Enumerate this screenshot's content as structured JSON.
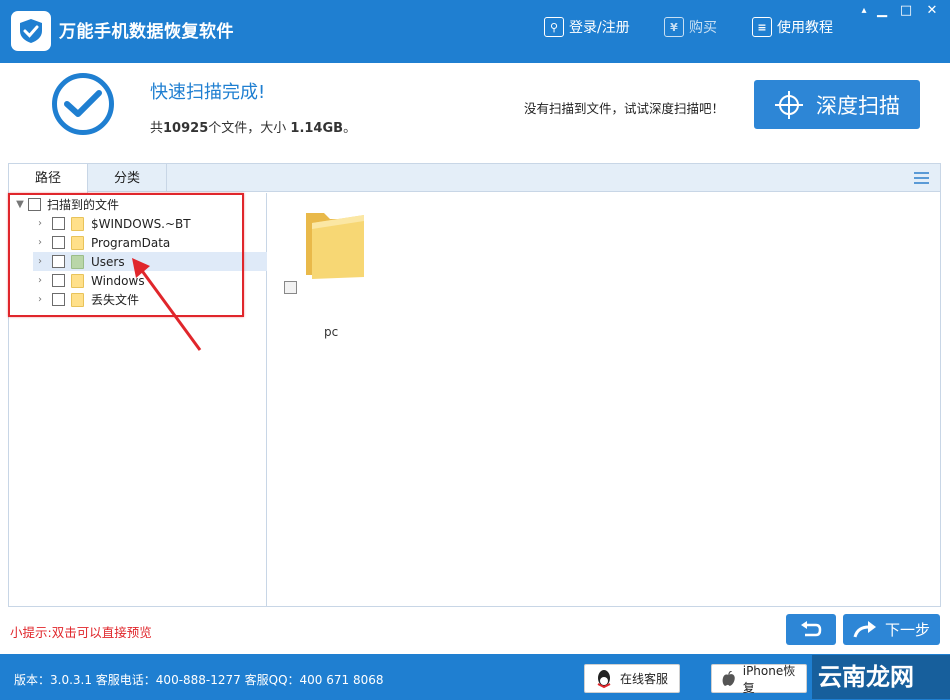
{
  "titlebar": {
    "title": "万能手机数据恢复软件",
    "login_label": "登录/注册",
    "buy_label": "购买",
    "tutorial_label": "使用教程"
  },
  "scan": {
    "status_title": "快速扫描完成!",
    "summary_prefix": "共",
    "file_count": "10925",
    "summary_mid": "个文件，大小",
    "total_size": "1.14GB",
    "summary_suffix": "。",
    "deep_hint": "没有扫描到文件，试试深度扫描吧！",
    "deep_scan_label": "深度扫描"
  },
  "tabs": [
    {
      "label": "路径"
    },
    {
      "label": "分类"
    }
  ],
  "tree": {
    "root_label": "扫描到的文件",
    "items": [
      {
        "label": "$WINDOWS.~BT",
        "icon": "folder-icon"
      },
      {
        "label": "ProgramData",
        "icon": "folder-icon"
      },
      {
        "label": "Users",
        "icon": "folder-icon"
      },
      {
        "label": "Windows",
        "icon": "folder-icon"
      },
      {
        "label": "丢失文件",
        "icon": "folder-icon"
      }
    ]
  },
  "files": [
    {
      "name": "pc"
    }
  ],
  "footer": {
    "tip": "小提示:双击可以直接预览",
    "next_label": "下一步"
  },
  "statusbar": {
    "info": "版本：3.0.3.1 客服电话：400-888-1277    客服QQ：400 671 8068",
    "online_service_label": "在线客服",
    "iphone_recovery_label": "iPhone恢复",
    "watermark": "云南龙网"
  },
  "colors": {
    "brand_blue": "#1f7fd1",
    "button_blue": "#2d86d6",
    "highlight_red": "#e0262b",
    "folder_yellow": "#ffe08a"
  }
}
